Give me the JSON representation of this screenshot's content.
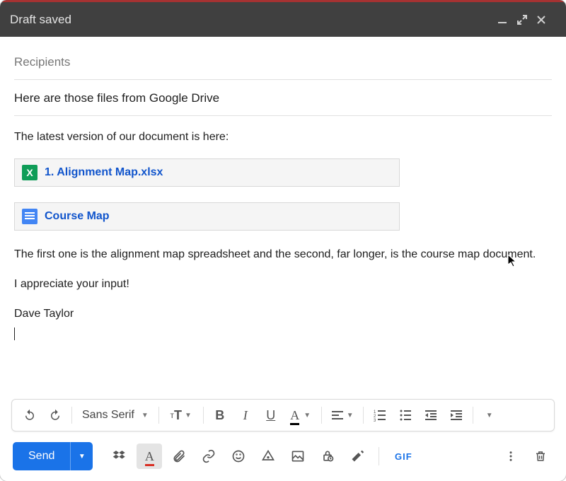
{
  "titlebar": {
    "title": "Draft saved"
  },
  "recipients_placeholder": "Recipients",
  "subject": "Here are those files from Google Drive",
  "body": {
    "intro": "The latest version of our document is here:",
    "attachments": [
      {
        "icon": "xls",
        "label": "1. Alignment Map.xlsx"
      },
      {
        "icon": "doc",
        "label": "Course Map"
      }
    ],
    "para2": "The first one is the alignment map spreadsheet and the second, far longer, is the course map document.",
    "para3": "I appreciate your input!",
    "signature": "Dave Taylor"
  },
  "format_toolbar": {
    "font": "Sans Serif"
  },
  "send_button": "Send",
  "gif_label": "GIF"
}
